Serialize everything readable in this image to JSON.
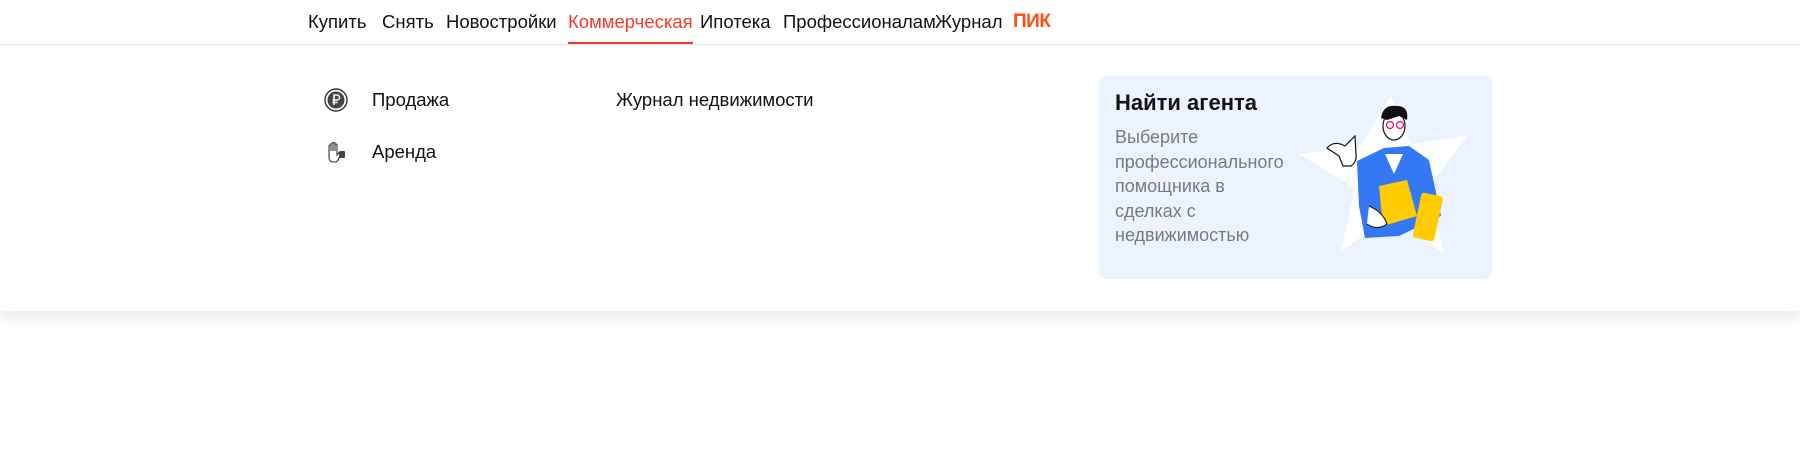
{
  "nav": {
    "items": [
      {
        "label": "Купить"
      },
      {
        "label": "Снять"
      },
      {
        "label": "Новостройки"
      },
      {
        "label": "Коммерческая",
        "active": true
      },
      {
        "label": "Ипотека"
      },
      {
        "label": "Профессионалам"
      },
      {
        "label": "Журнал"
      },
      {
        "label": "ПИК"
      }
    ]
  },
  "menu": {
    "items": [
      {
        "label": "Продажа",
        "icon": "ruble-coin-icon"
      },
      {
        "label": "Аренда",
        "icon": "hand-key-icon"
      }
    ],
    "journal_link": "Журнал недвижимости"
  },
  "promo": {
    "title": "Найти агента",
    "text": "Выберите профессионального помощника в сделках с недвижимостью"
  },
  "colors": {
    "accent": "#f33a2c",
    "pik": "#ff4f12",
    "card_bg": "#ebf3ff",
    "jacket": "#3478f6",
    "folder": "#ffcc00"
  }
}
